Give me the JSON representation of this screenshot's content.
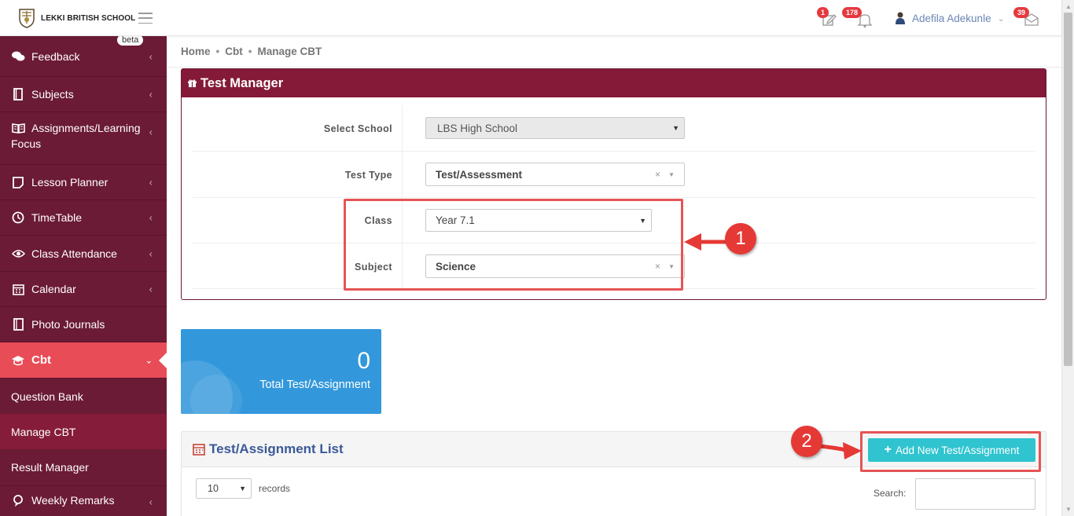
{
  "header": {
    "logo_text": "LEKKI BRITISH SCHOOL",
    "notif_edit_count": "1",
    "notif_bell_count": "178",
    "user_name": "Adefila Adekunle",
    "notif_mail_count": "39"
  },
  "sidebar": {
    "items": [
      {
        "label": "Feedback",
        "badge": "beta"
      },
      {
        "label": "Subjects"
      },
      {
        "label_line1": "Assignments/Learning",
        "label_line2": "Focus"
      },
      {
        "label": "Lesson Planner"
      },
      {
        "label": "TimeTable"
      },
      {
        "label": "Class Attendance"
      },
      {
        "label": "Calendar"
      },
      {
        "label": "Photo Journals"
      },
      {
        "label": "Cbt"
      }
    ],
    "subitems": [
      {
        "label": "Question Bank"
      },
      {
        "label": "Manage CBT"
      },
      {
        "label": "Result Manager"
      }
    ],
    "last_item": {
      "label": "Weekly Remarks"
    }
  },
  "breadcrumb": {
    "home": "Home",
    "section": "Cbt",
    "page": "Manage CBT"
  },
  "test_manager": {
    "title": "Test Manager",
    "fields": {
      "school_label": "Select School",
      "school_value": "LBS High School",
      "test_type_label": "Test Type",
      "test_type_value": "Test/Assessment",
      "class_label": "Class",
      "class_value": "Year 7.1",
      "subject_label": "Subject",
      "subject_value": "Science"
    }
  },
  "annotations": {
    "step1": "1",
    "step2": "2",
    "color": "#e53935"
  },
  "stat_card": {
    "value": "0",
    "label": "Total Test/Assignment",
    "color": "#3398db"
  },
  "list": {
    "title": "Test/Assignment List",
    "add_button": "Add New Test/Assignment",
    "records_value": "10",
    "records_label": "records",
    "search_label": "Search:"
  },
  "colors": {
    "sidebar_bg": "#6b1b35",
    "active_bg": "#e84c57",
    "panel_head": "#841a38",
    "button": "#2fc4cf"
  }
}
